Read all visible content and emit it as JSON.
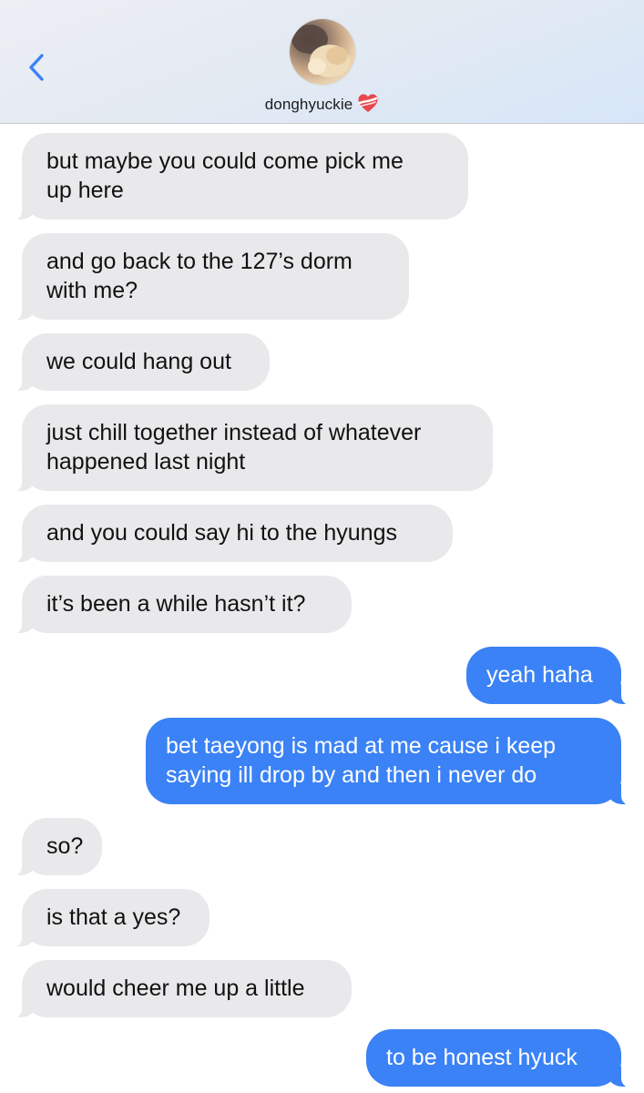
{
  "header": {
    "contact_name": "donghyuckie",
    "back_icon": "chevron-left-icon",
    "heart_icon": "heart-ribbon-icon",
    "accent_color": "#3b82f6"
  },
  "messages": [
    {
      "dir": "incoming",
      "text": "but maybe you could come pick me\nup here"
    },
    {
      "dir": "incoming",
      "text": "and go back to the 127’s dorm\nwith me?"
    },
    {
      "dir": "incoming",
      "text": "we could hang out"
    },
    {
      "dir": "incoming",
      "text": "just chill together instead of whatever\nhappened last night"
    },
    {
      "dir": "incoming",
      "text": "and you could say hi to the hyungs"
    },
    {
      "dir": "incoming",
      "text": "it’s been a while hasn’t it?"
    },
    {
      "dir": "outgoing",
      "text": "yeah haha"
    },
    {
      "dir": "outgoing",
      "text": "bet taeyong is mad at me cause i keep\nsaying ill drop by and then i never do"
    },
    {
      "dir": "incoming",
      "text": "so?"
    },
    {
      "dir": "incoming",
      "text": "is that a yes?"
    },
    {
      "dir": "incoming",
      "text": "would cheer me up a little"
    },
    {
      "dir": "outgoing",
      "text": "to be honest hyuck"
    }
  ]
}
